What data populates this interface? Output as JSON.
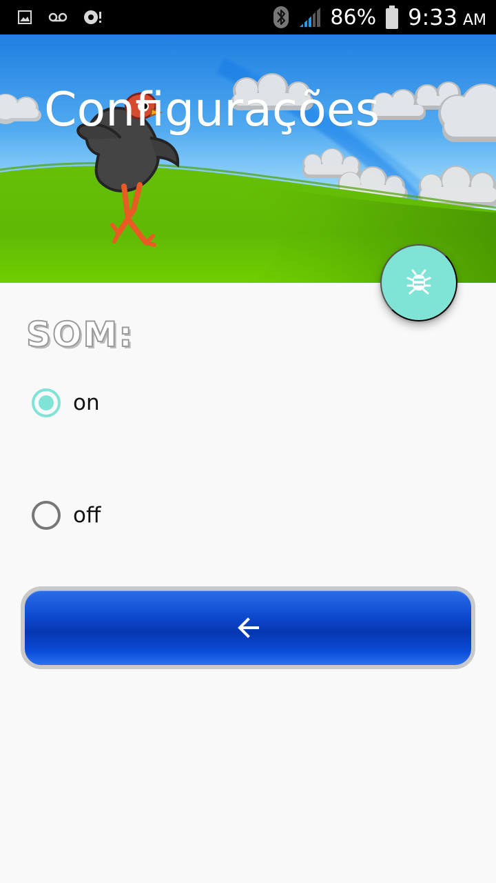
{
  "status_bar": {
    "battery": "86%",
    "time": "9:33",
    "am_pm": "AM",
    "icons": [
      "image-notification-icon",
      "voicemail-icon",
      "sync-alert-icon",
      "bluetooth-icon",
      "signal-icon",
      "battery-icon"
    ]
  },
  "header": {
    "title": "Configurações",
    "image": "running-chicken-on-green-hill-with-clouds"
  },
  "fab": {
    "icon": "bug-icon",
    "color": "#7fe3d5"
  },
  "sound": {
    "label": "SOM:",
    "options": [
      {
        "label": "on",
        "selected": true
      },
      {
        "label": "off",
        "selected": false
      }
    ]
  },
  "back_button": {
    "icon": "arrow-back-icon",
    "color": "#0b4cd8"
  },
  "colors": {
    "accent": "#7fe3d5",
    "status_bar": "#000000",
    "background": "#f9f9f9",
    "button_blue": "#0b4cd8"
  }
}
